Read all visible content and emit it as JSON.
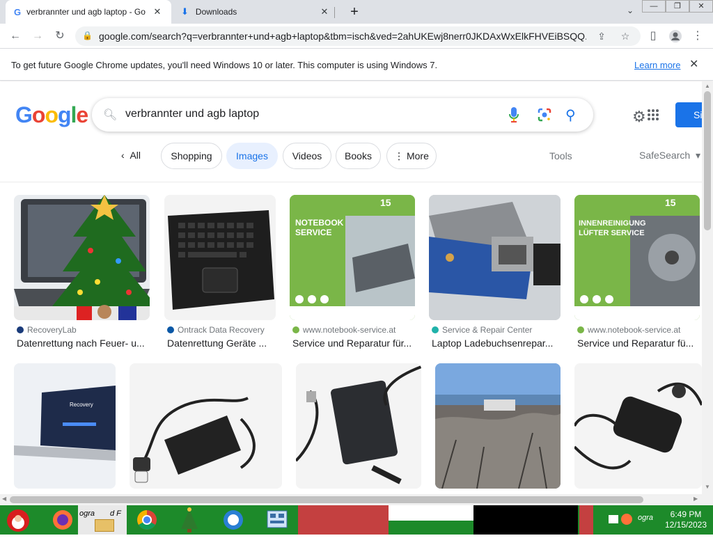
{
  "browser": {
    "tabs": [
      {
        "label": "verbrannter und agb laptop - Go",
        "active": true
      },
      {
        "label": "Downloads",
        "active": false
      }
    ],
    "new_tab": "+",
    "url": "google.com/search?q=verbrannter+und+agb+laptop&tbm=isch&ved=2ahUKEwj8nerr0JKDAxWxElkFHVEiBSQQ...",
    "window_buttons": {
      "minimize": "—",
      "maximize": "❐",
      "close": "✕"
    }
  },
  "infobar": {
    "message": "To get future Google Chrome updates, you'll need Windows 10 or later. This computer is using Windows 7.",
    "link": "Learn more",
    "close": "✕"
  },
  "search": {
    "logo": [
      "G",
      "o",
      "o",
      "g",
      "l",
      "e"
    ],
    "query": "verbrannter und agb laptop",
    "signin_label": "Si"
  },
  "chips": {
    "back": "All",
    "items": [
      "Shopping",
      "Images",
      "Videos",
      "Books",
      "More"
    ],
    "selected": "Images",
    "tools": "Tools",
    "safesearch": "SafeSearch"
  },
  "results_row1": [
    {
      "source": "RecoveryLab",
      "title": "Datenrettung nach Feuer- u...",
      "fav_color": "#1a3b7a"
    },
    {
      "source": "Ontrack Data Recovery",
      "title": "Datenrettung Geräte ...",
      "fav_color": "#0a58a6"
    },
    {
      "source": "www.notebook-service.at",
      "title": "Service und Reparatur für...",
      "fav_color": "#7ab648"
    },
    {
      "source": "Service & Repair Center",
      "title": "Laptop Ladebuchsenrepar...",
      "fav_color": "#20b2aa"
    },
    {
      "source": "www.notebook-service.at",
      "title": "Service und Reparatur fü...",
      "fav_color": "#7ab648"
    }
  ],
  "thumb_text": {
    "notebook_service": "NOTEBOOK SERVICE",
    "innenreinigung": "INNENREINIGUNG LÜFTER SERVICE",
    "recovery": "Recovery"
  },
  "taskbar": {
    "clock_time": "6:49 PM",
    "clock_date": "12/15/2023",
    "item_text_1": "ogra",
    "item_text_2": "d F",
    "tray_text": "ogra"
  }
}
